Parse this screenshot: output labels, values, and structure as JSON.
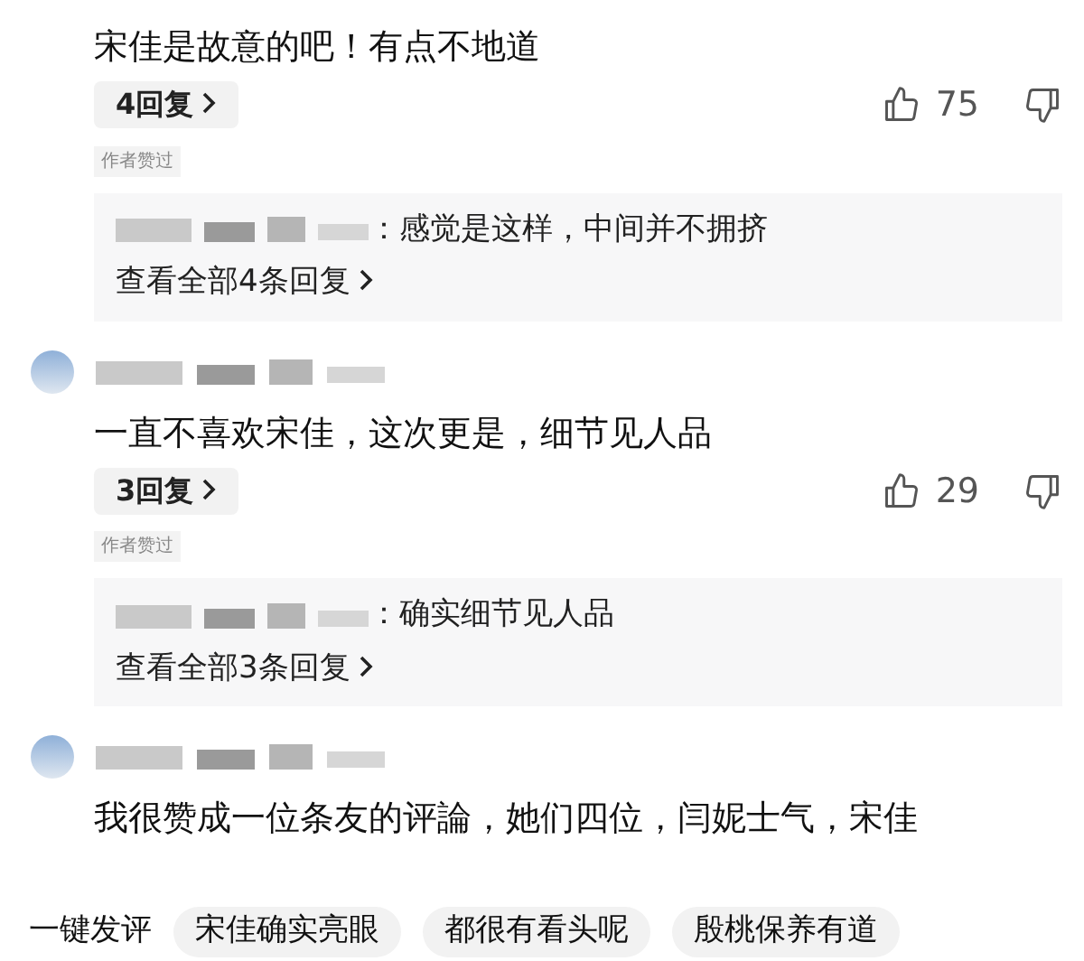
{
  "comments": [
    {
      "header_visible": false,
      "text": "宋佳是故意的吧！有点不地道",
      "replies": "4回复",
      "likes": "75",
      "author_liked": true,
      "author_liked_label": "作者赞过",
      "reply_preview": {
        "text": "：感觉是这样，中间并不拥挤",
        "view_all": "查看全部4条回复"
      }
    },
    {
      "header_visible": true,
      "text": "一直不喜欢宋佳，这次更是，细节见人品",
      "replies": "3回复",
      "likes": "29",
      "author_liked": true,
      "author_liked_label": "作者赞过",
      "reply_preview": {
        "text": "：确实细节见人品",
        "view_all": "查看全部3条回复"
      }
    },
    {
      "header_visible": true,
      "text": "我很赞成一位条友的评論，她们四位，闫妮士气，宋佳"
    }
  ],
  "quick_reply": {
    "label": "一键发评",
    "chips": [
      "宋佳确实亮眼",
      "都很有看头呢",
      "殷桃保养有道"
    ]
  }
}
